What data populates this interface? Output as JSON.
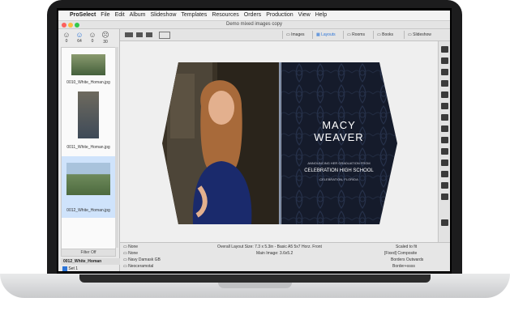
{
  "menubar": {
    "apple": "",
    "items": [
      "ProSelect",
      "File",
      "Edit",
      "Album",
      "Slideshow",
      "Templates",
      "Resources",
      "Orders",
      "Production",
      "View",
      "Help"
    ]
  },
  "window": {
    "title": "Demo mixed images copy"
  },
  "sidebar": {
    "faces": [
      {
        "label": "0"
      },
      {
        "label": "64"
      },
      {
        "label": "0"
      },
      {
        "label": "30"
      }
    ],
    "thumbnails": [
      {
        "caption": "0010_White_Homan.jpg"
      },
      {
        "caption": "0011_White_Homan.jpg"
      },
      {
        "caption": "0012_White_Homan.jpg"
      }
    ],
    "filter_label": "Filter Off",
    "set_header": "0012_White_Homan",
    "set_item": "Set 1"
  },
  "toolbar": {
    "tabs": [
      "Images",
      "Layouts",
      "Rooms",
      "Books",
      "Slideshow"
    ],
    "active_tab": "Layouts"
  },
  "card": {
    "name_line1": "MACY",
    "name_line2": "WEAVER",
    "announce": "ANNOUNCING HER GRADUATION FROM",
    "school": "CELEBRATION HIGH SCHOOL",
    "city": "CELEBRATION, FLORIDA"
  },
  "bottom": {
    "left_rows": [
      "None",
      "None",
      "Navy Damask GB",
      "Neoceramotal"
    ],
    "layout_size": "Overall Layout Size: 7.3 x 5.3in - Basic A5 5x7 Horz. Front",
    "main_image": "Main Image: 3.6x5.2",
    "right_rows": [
      "Scaled to fit",
      "[Fixed] Composite",
      "Borders Outwards",
      "Border+ssss"
    ]
  },
  "colors": {
    "card_bg": "#151b2b",
    "dress": "#1a2a6c",
    "accent_blue": "#2b74d8"
  }
}
